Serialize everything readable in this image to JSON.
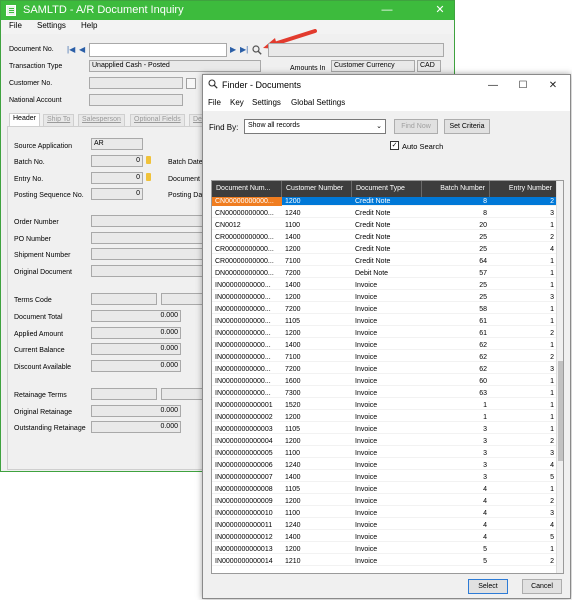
{
  "main": {
    "title": "SAMLTD - A/R Document Inquiry",
    "menu": [
      "File",
      "Settings",
      "Help"
    ],
    "labels": {
      "document_no": "Document No.",
      "transaction_type": "Transaction Type",
      "customer_no": "Customer No.",
      "national_account": "National Account",
      "amounts_in": "Amounts In"
    },
    "transaction_type_value": "Unapplied Cash - Posted",
    "amounts_in_value": "Customer Currency",
    "currency": "CAD",
    "tabs": [
      "Header",
      "Ship To",
      "Salesperson",
      "Optional Fields",
      "Det"
    ],
    "header": {
      "source_application_label": "Source Application",
      "source_application_value": "AR",
      "batch_no_label": "Batch No.",
      "batch_no_value": "0",
      "batch_date_label": "Batch Date",
      "entry_no_label": "Entry No.",
      "entry_no_value": "0",
      "document_label": "Document",
      "posting_seq_label": "Posting Sequence No.",
      "posting_seq_value": "0",
      "posting_date_label": "Posting Da",
      "order_number_label": "Order Number",
      "po_number_label": "PO Number",
      "shipment_number_label": "Shipment Number",
      "original_document_label": "Original Document",
      "terms_code_label": "Terms Code",
      "document_total_label": "Document Total",
      "document_total_value": "0.000",
      "applied_amount_label": "Applied Amount",
      "applied_amount_value": "0.000",
      "current_balance_label": "Current Balance",
      "current_balance_value": "0.000",
      "discount_available_label": "Discount Available",
      "discount_available_value": "0.000",
      "retainage_terms_label": "Retainage Terms",
      "original_retainage_label": "Original Retainage",
      "original_retainage_value": "0.000",
      "outstanding_retainage_label": "Outstanding Retainage",
      "outstanding_retainage_value": "0.000"
    }
  },
  "finder": {
    "title": "Finder - Documents",
    "menu": [
      "File",
      "Key",
      "Settings",
      "Global Settings"
    ],
    "find_by_label": "Find By:",
    "find_by_value": "Show all records",
    "find_now_label": "Find Now",
    "set_criteria_label": "Set Criteria",
    "auto_search_label": "Auto Search",
    "auto_search_checked": true,
    "select_label": "Select",
    "cancel_label": "Cancel",
    "columns": [
      "Document Num...",
      "Customer Number",
      "Document Type",
      "Batch Number",
      "Entry Number"
    ],
    "rows": [
      [
        "CN00000000000...",
        "1200",
        "Credit Note",
        "8",
        "2"
      ],
      [
        "CN00000000000...",
        "1240",
        "Credit Note",
        "8",
        "3"
      ],
      [
        "CN0012",
        "1100",
        "Credit Note",
        "20",
        "1"
      ],
      [
        "CR00000000000...",
        "1400",
        "Credit Note",
        "25",
        "2"
      ],
      [
        "CR00000000000...",
        "1200",
        "Credit Note",
        "25",
        "4"
      ],
      [
        "CR00000000000...",
        "7100",
        "Credit Note",
        "64",
        "1"
      ],
      [
        "DN00000000000...",
        "7200",
        "Debit Note",
        "57",
        "1"
      ],
      [
        "IN00000000000...",
        "1400",
        "Invoice",
        "25",
        "1"
      ],
      [
        "IN00000000000...",
        "1200",
        "Invoice",
        "25",
        "3"
      ],
      [
        "IN00000000000...",
        "7200",
        "Invoice",
        "58",
        "1"
      ],
      [
        "IN00000000000...",
        "1105",
        "Invoice",
        "61",
        "1"
      ],
      [
        "IN00000000000...",
        "1200",
        "Invoice",
        "61",
        "2"
      ],
      [
        "IN00000000000...",
        "1400",
        "Invoice",
        "62",
        "1"
      ],
      [
        "IN00000000000...",
        "7100",
        "Invoice",
        "62",
        "2"
      ],
      [
        "IN00000000000...",
        "7200",
        "Invoice",
        "62",
        "3"
      ],
      [
        "IN00000000000...",
        "1600",
        "Invoice",
        "60",
        "1"
      ],
      [
        "IN00000000000...",
        "7300",
        "Invoice",
        "63",
        "1"
      ],
      [
        "IN0000000000001",
        "1520",
        "Invoice",
        "1",
        "1"
      ],
      [
        "IN0000000000002",
        "1200",
        "Invoice",
        "1",
        "1"
      ],
      [
        "IN0000000000003",
        "1105",
        "Invoice",
        "3",
        "1"
      ],
      [
        "IN0000000000004",
        "1200",
        "Invoice",
        "3",
        "2"
      ],
      [
        "IN0000000000005",
        "1100",
        "Invoice",
        "3",
        "3"
      ],
      [
        "IN0000000000006",
        "1240",
        "Invoice",
        "3",
        "4"
      ],
      [
        "IN0000000000007",
        "1400",
        "Invoice",
        "3",
        "5"
      ],
      [
        "IN0000000000008",
        "1105",
        "Invoice",
        "4",
        "1"
      ],
      [
        "IN0000000000009",
        "1200",
        "Invoice",
        "4",
        "2"
      ],
      [
        "IN0000000000010",
        "1100",
        "Invoice",
        "4",
        "3"
      ],
      [
        "IN0000000000011",
        "1240",
        "Invoice",
        "4",
        "4"
      ],
      [
        "IN0000000000012",
        "1400",
        "Invoice",
        "4",
        "5"
      ],
      [
        "IN0000000000013",
        "1200",
        "Invoice",
        "5",
        "1"
      ],
      [
        "IN0000000000014",
        "1210",
        "Invoice",
        "5",
        "2"
      ]
    ]
  },
  "colors": {
    "main_titlebar": "#3dbb3d",
    "highlight_row": "#0078d7",
    "highlight_cell": "#f07d20",
    "arrow": "#e23b2e"
  }
}
